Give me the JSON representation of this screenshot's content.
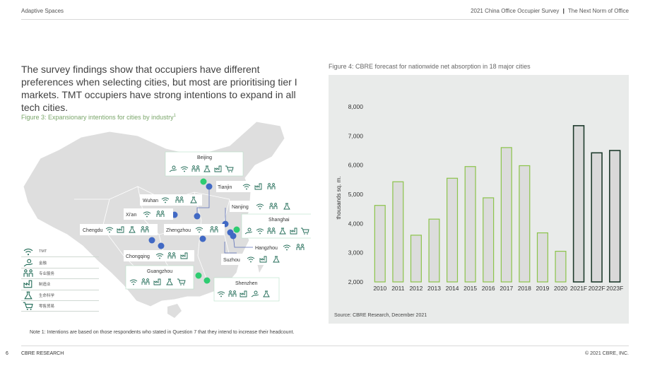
{
  "header": {
    "left": "Adaptive Spaces",
    "right_a": "2021 China Office Occupier Survey",
    "separator": "|",
    "right_b": "The Next Norm of Office"
  },
  "intro": "The survey findings show that occupiers have different preferences when selecting cities, but most are prioritising tier I markets. TMT occupiers have strong intentions to expand in all tech cities.",
  "figure3": {
    "title": "Figure 3: Expansionary intentions for cities by industry",
    "title_sup": "1",
    "cities": [
      "Beijing",
      "Tianjin",
      "Wuhan",
      "Nanjing",
      "Xi'an",
      "Shanghai",
      "Chengdu",
      "Zhengzhou",
      "Hangzhou",
      "Chongqing",
      "Suzhou",
      "Guangzhou",
      "Shenzhen"
    ],
    "legend": [
      "TMT",
      "金融",
      "专业服务",
      "制造业",
      "生命科学",
      "零售贸易"
    ],
    "note": "Note 1: Intentions are based on those respondents who stated in Question 7 that they intend to increase their headcount."
  },
  "figure4": {
    "title": "Figure 4: CBRE forecast for nationwide net absorption in 18 major cities",
    "source": "Source: CBRE Research, December 2021"
  },
  "chart_data": {
    "type": "bar",
    "categories": [
      "2010",
      "2011",
      "2012",
      "2013",
      "2014",
      "2015",
      "2016",
      "2017",
      "2018",
      "2019",
      "2020",
      "2021F",
      "2022F",
      "2023F"
    ],
    "values": [
      4620,
      5430,
      3600,
      4150,
      5550,
      5950,
      4880,
      6600,
      5980,
      3680,
      3050,
      7350,
      6420,
      6500
    ],
    "forecast": [
      false,
      false,
      false,
      false,
      false,
      false,
      false,
      false,
      false,
      false,
      false,
      true,
      true,
      true
    ],
    "title": "Figure 4: CBRE forecast for nationwide net absorption in 18 major cities",
    "xlabel": "",
    "ylabel": "thousands sq. m.",
    "ylim": [
      2000,
      8000
    ],
    "yticks": [
      2000,
      3000,
      4000,
      5000,
      6000,
      7000,
      8000
    ],
    "ytick_labels": [
      "2,000",
      "3,000",
      "4,000",
      "5,000",
      "6,000",
      "7,000",
      "8,000"
    ],
    "grid": false,
    "legend": "none",
    "colors": {
      "actual_fill": "#dcdcdc",
      "actual_stroke": "#8bc34a",
      "forecast_fill": "#d9d9d9",
      "forecast_stroke": "#1f3b2d",
      "background": "#e9ebea"
    }
  },
  "footer": {
    "page": "6",
    "left": "CBRE RESEARCH",
    "right": "© 2021 CBRE, INC."
  }
}
